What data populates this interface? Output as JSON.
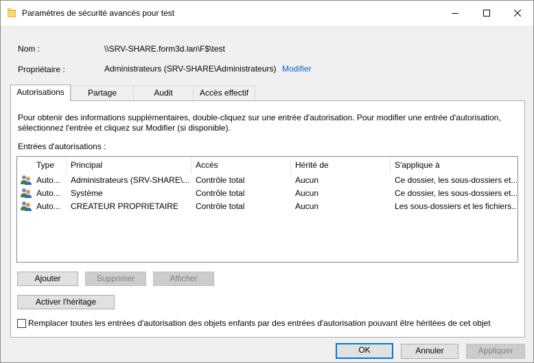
{
  "window": {
    "title": "Paramètres de sécurité avancés pour test"
  },
  "info": {
    "name_label": "Nom :",
    "name_value": "\\\\SRV-SHARE.form3d.lan\\F$\\test",
    "owner_label": "Propriétaire :",
    "owner_value": "Administrateurs (SRV-SHARE\\Administrateurs)",
    "owner_link": "Modifier"
  },
  "tabs": [
    {
      "label": "Autorisations"
    },
    {
      "label": "Partage"
    },
    {
      "label": "Audit"
    },
    {
      "label": "Accès effectif"
    }
  ],
  "permissions": {
    "description": "Pour obtenir des informations supplémentaires, double-cliquez sur une entrée d'autorisation. Pour modifier une entrée d'autorisation, sélectionnez l'entrée et cliquez sur Modifier (si disponible).",
    "entries_label": "Entrées d'autorisations :",
    "columns": [
      "Type",
      "Principal",
      "Accès",
      "Hérité de",
      "S'applique à"
    ],
    "rows": [
      {
        "type": "Auto...",
        "principal": "Administrateurs (SRV-SHARE\\...",
        "access": "Contrôle total",
        "inherited": "Aucun",
        "applies": "Ce dossier, les sous-dossiers et..."
      },
      {
        "type": "Auto...",
        "principal": "Système",
        "access": "Contrôle total",
        "inherited": "Aucun",
        "applies": "Ce dossier, les sous-dossiers et..."
      },
      {
        "type": "Auto...",
        "principal": "CREATEUR PROPRIETAIRE",
        "access": "Contrôle total",
        "inherited": "Aucun",
        "applies": "Les sous-dossiers et les fichiers..."
      }
    ],
    "buttons": {
      "add": "Ajouter",
      "remove": "Supprimer",
      "view": "Afficher",
      "inheritance": "Activer l'héritage"
    },
    "replace_checkbox_label": "Remplacer toutes les entrées d'autorisation des objets enfants par des entrées d'autorisation pouvant être héritées de cet objet",
    "replace_checked": false
  },
  "footer": {
    "ok": "OK",
    "cancel": "Annuler",
    "apply": "Appliquer"
  },
  "icons": {
    "title": "folder-icon",
    "row": "users-icon"
  }
}
